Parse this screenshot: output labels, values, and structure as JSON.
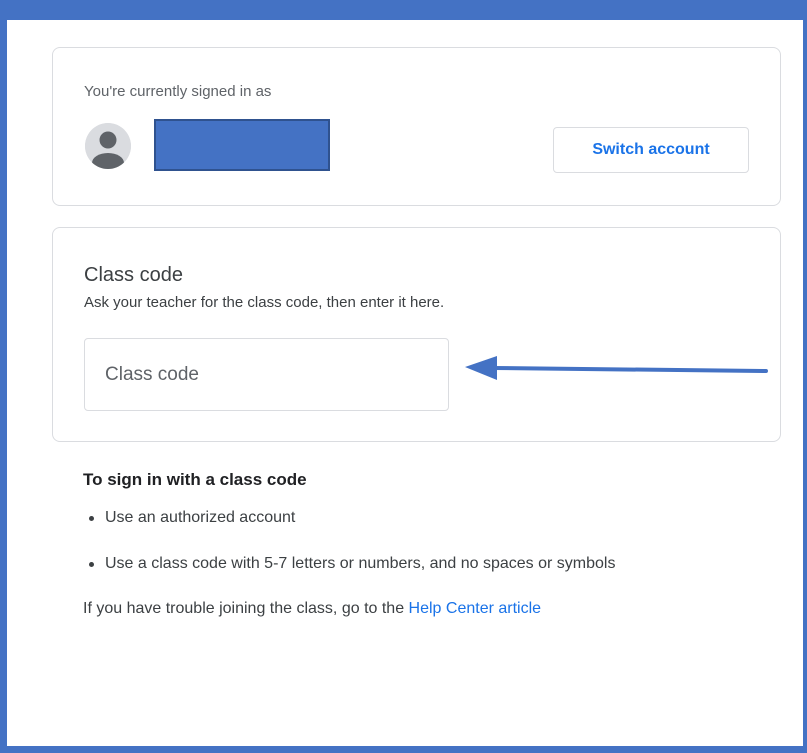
{
  "account": {
    "signed_in_label": "You're currently signed in as",
    "switch_button": "Switch account"
  },
  "class_code": {
    "title": "Class code",
    "subtitle": "Ask your teacher for the class code, then enter it here.",
    "input_value": "",
    "input_placeholder": "Class code"
  },
  "info": {
    "heading": "To sign in with a class code",
    "items": [
      "Use an authorized account",
      "Use a class code with 5-7 letters or numbers, and no spaces or symbols"
    ],
    "help_prefix": "If you have trouble joining the class, go to the",
    "help_link": "Help Center article"
  },
  "colors": {
    "accent": "#1a73e8",
    "annotation": "#4472c4",
    "border": "#dadce0",
    "text": "#3c4043"
  },
  "icons": {
    "avatar": "person-avatar-icon",
    "annotation": "arrow-left-icon"
  }
}
